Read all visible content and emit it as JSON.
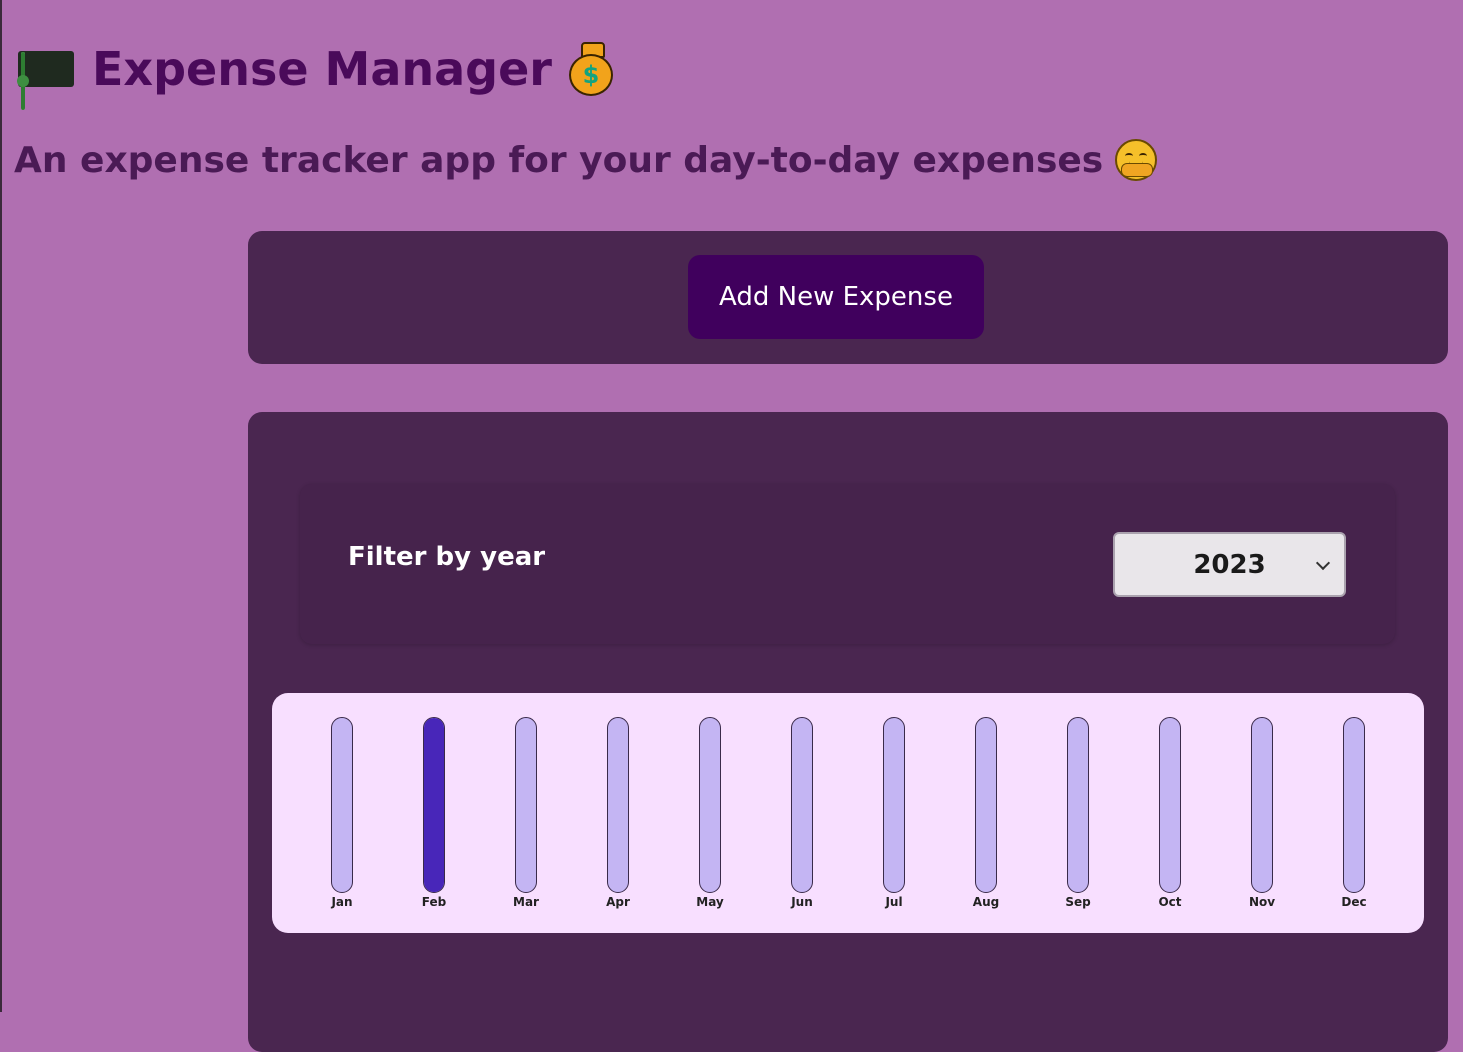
{
  "header": {
    "title": "Expense Manager",
    "title_left_icon": "money-bill-icon",
    "title_right_icon": "money-bag-icon",
    "subtitle": "An expense tracker app for your day-to-day expenses",
    "subtitle_icon": "hugging-face-icon"
  },
  "actions": {
    "add_expense_label": "Add New Expense"
  },
  "filter": {
    "label": "Filter by year",
    "selected_year": "2023"
  },
  "colors": {
    "page_background": "#b06fb1",
    "panel_background": "#4a2650",
    "button_background": "#40005d",
    "chart_background": "#f8dfff",
    "bar_track": "#c4b5f3",
    "bar_fill": "#4826b9"
  },
  "chart_data": {
    "type": "bar",
    "categories": [
      "Jan",
      "Feb",
      "Mar",
      "Apr",
      "May",
      "Jun",
      "Jul",
      "Aug",
      "Sep",
      "Oct",
      "Nov",
      "Dec"
    ],
    "values": [
      0,
      100,
      0,
      0,
      0,
      0,
      0,
      0,
      0,
      0,
      0,
      0
    ],
    "ylim": [
      0,
      100
    ],
    "grid": false
  }
}
